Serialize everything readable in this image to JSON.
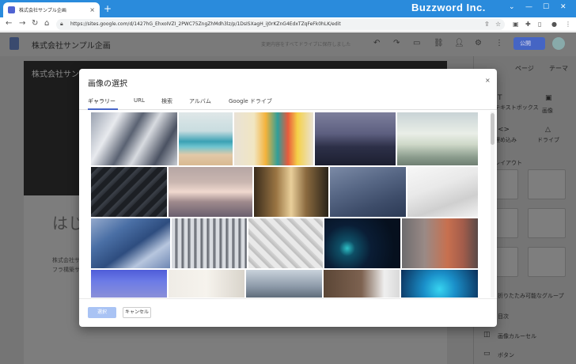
{
  "browser": {
    "tab_title": "株式会社サンプル企画",
    "tab_close": "×",
    "new_tab": "+",
    "brand": "Buzzword Inc.",
    "url": "https://sites.google.com/d/1427hG_EhxoIVZI_2PWC75ZngZhMdh3lz/p/1DsISXagH_iJ0rKZnG4EdxTZqFeFk0hLK/edit",
    "window_controls": [
      "⌄",
      "—",
      "☐",
      "✕"
    ]
  },
  "app": {
    "site_title": "株式会社サンプル企画",
    "header_hint": "変更内容をすべてドライブに保存しました",
    "publish_label": "公開",
    "hero_title": "株式会社サン",
    "heading_fragment": "はじ",
    "body_fragment_1": "株式会社サ",
    "body_fragment_2": "フラ構築サ"
  },
  "side_panel": {
    "tabs": [
      "ページ",
      "テーマ"
    ],
    "items": {
      "text_box": "テキストボックス",
      "image": "画像",
      "embed": "埋め込み",
      "drive": "ドライブ",
      "layout": "レイアウト",
      "collapsible": "折りたたみ可能なグループ",
      "toc": "目次",
      "carousel": "画像カルーセル",
      "button": "ボタン"
    }
  },
  "dialog": {
    "title": "画像の選択",
    "close": "×",
    "tabs": [
      "ギャラリー",
      "URL",
      "検索",
      "アルバム",
      "Google ドライブ"
    ],
    "active_tab": "ギャラリー",
    "select_label": "選択",
    "cancel_label": "キャンセル"
  },
  "colors": {
    "accent": "#4765c8",
    "chrome": "#2a8bdc"
  }
}
